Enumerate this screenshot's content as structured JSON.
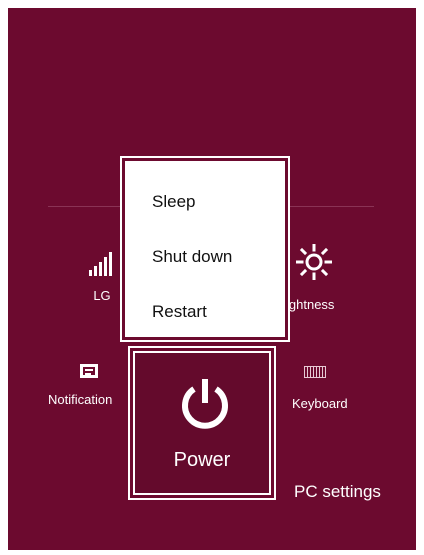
{
  "quick_settings": {
    "network": {
      "label": "LG",
      "icon": "signal-bars-icon"
    },
    "brightness": {
      "label": "ightness",
      "icon": "sun-icon"
    },
    "notifications": {
      "label": "Notification",
      "icon": "notification-icon"
    },
    "keyboard": {
      "label": "Keyboard",
      "icon": "keyboard-icon"
    },
    "pc_settings_label": "PC settings"
  },
  "power": {
    "label": "Power",
    "icon": "power-icon",
    "menu": [
      {
        "label": "Sleep"
      },
      {
        "label": "Shut down"
      },
      {
        "label": "Restart"
      }
    ]
  },
  "colors": {
    "background": "#6c0a2f",
    "menu_background": "#ffffff",
    "text": "#ffffff"
  }
}
